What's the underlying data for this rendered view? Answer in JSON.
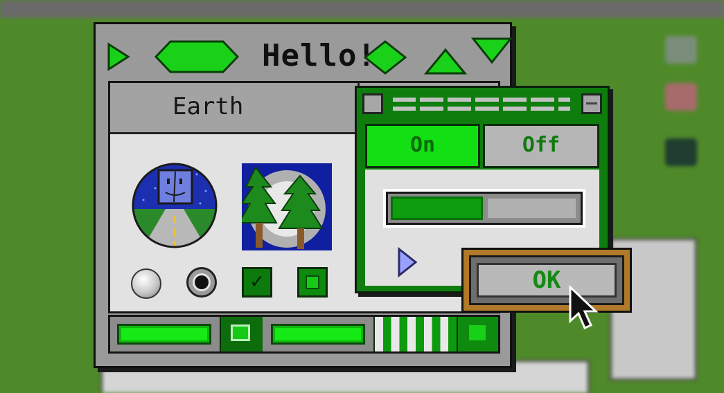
{
  "window": {
    "title": "Hello!"
  },
  "tabs": [
    {
      "label": "Earth"
    }
  ],
  "toggle": {
    "on_label": "On",
    "off_label": "Off",
    "selected": "On"
  },
  "slider": {
    "level": 0.5
  },
  "dialog": {
    "ok_label": "OK"
  },
  "controls": {
    "radio_unselected": "off",
    "radio_selected": "on",
    "checkbox_checked": true
  },
  "icons": {
    "finder_scene": "finder-face-road-icon",
    "forest_scene": "pine-trees-icon",
    "disclosure": "disclosure-triangle-icon",
    "cursor": "arrow-cursor-icon"
  },
  "colors": {
    "accent_green": "#18d118",
    "dark_green": "#0e7d0e",
    "window_gray": "#9a9a9a",
    "panel_gray": "#e2e2e2",
    "ok_frame": "#b07a2a",
    "desktop": "#4f8a2a"
  }
}
